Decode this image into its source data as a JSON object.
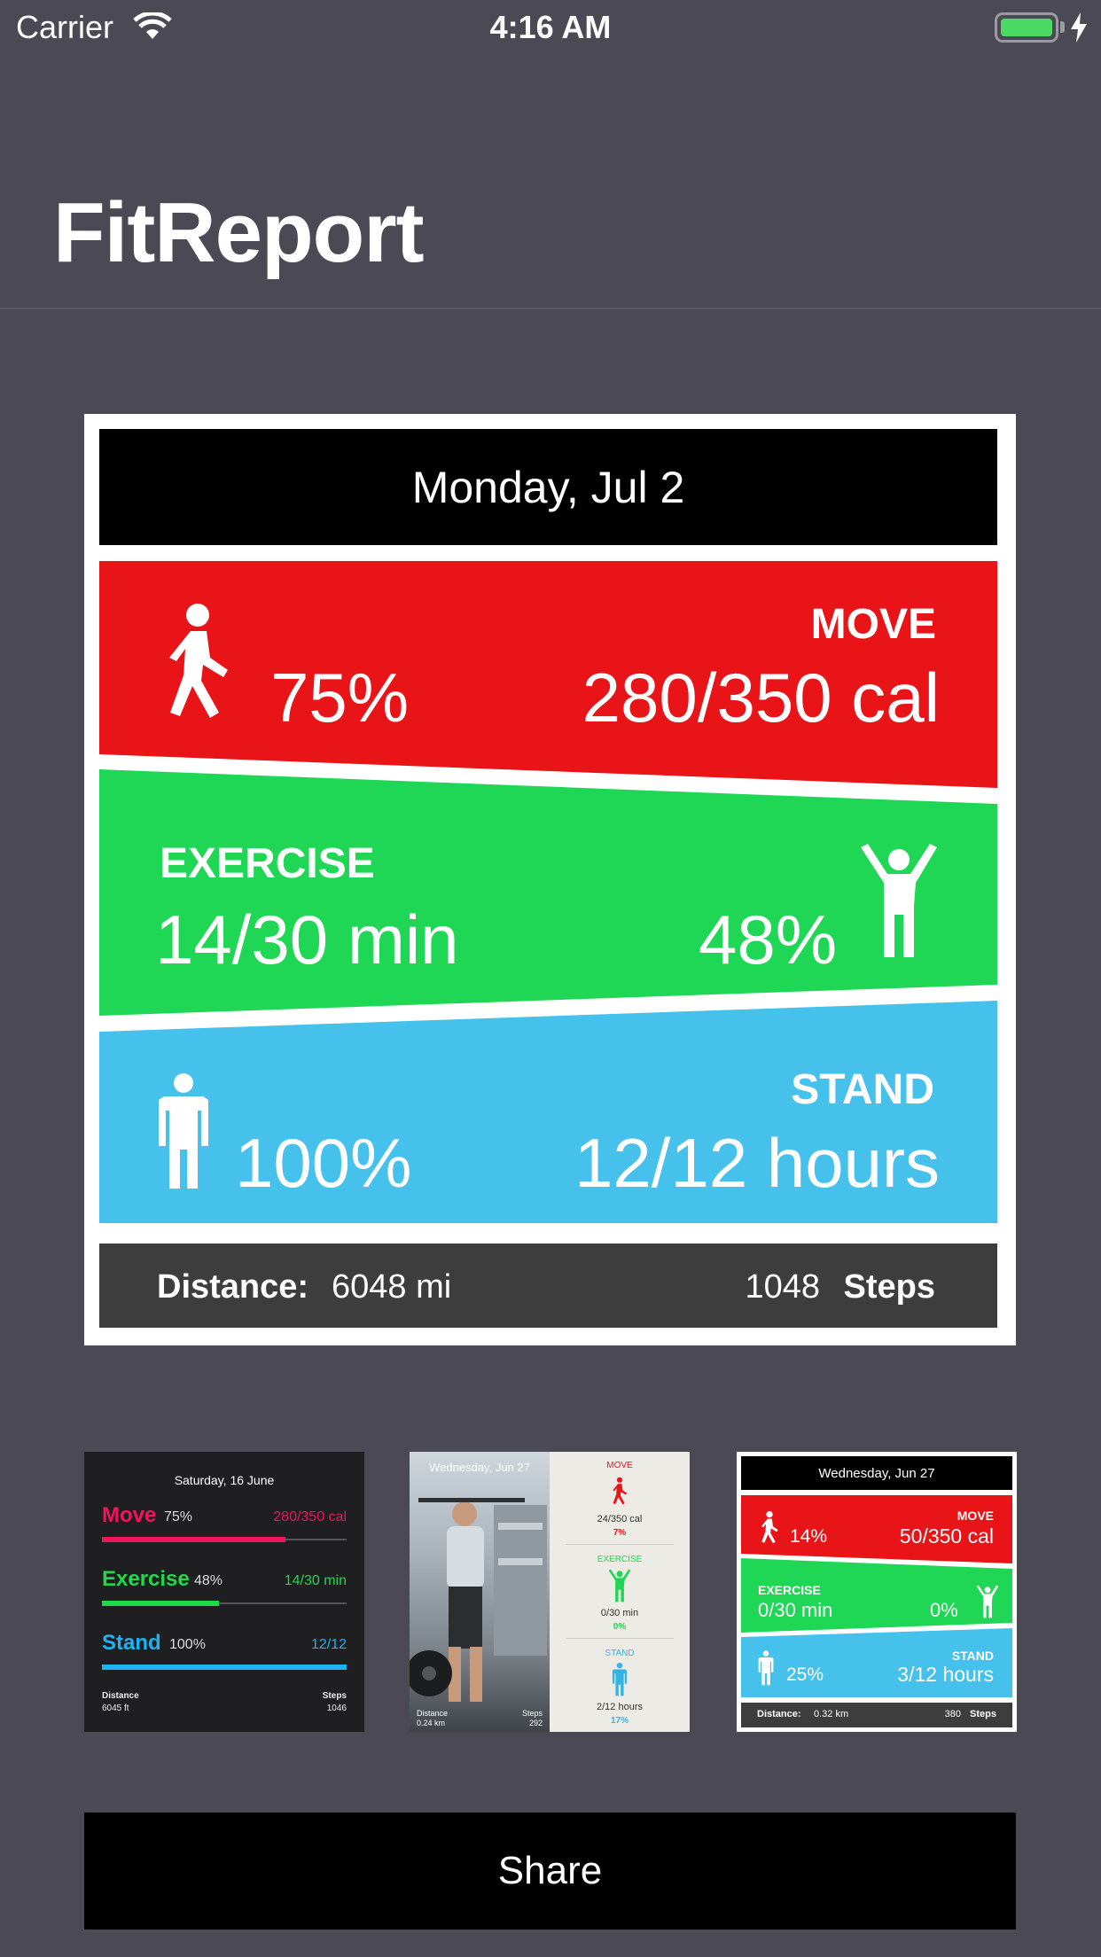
{
  "status_bar": {
    "carrier": "Carrier",
    "time": "4:16 AM",
    "battery_color": "#4cd964"
  },
  "app": {
    "title": "FitReport"
  },
  "main_card": {
    "date": "Monday, Jul 2",
    "move": {
      "label": "MOVE",
      "percent": "75%",
      "value": "280/350 cal",
      "color": "#e81417"
    },
    "exercise": {
      "label": "EXERCISE",
      "percent": "48%",
      "value": "14/30 min",
      "color": "#1fd655"
    },
    "stand": {
      "label": "STAND",
      "percent": "100%",
      "value": "12/12 hours",
      "color": "#46c1ec"
    },
    "distance_label": "Distance:",
    "distance_value": "6048 mi",
    "steps_value": "1048",
    "steps_label": "Steps"
  },
  "thumbnails": [
    {
      "style": "dark-bars",
      "date": "Saturday, 16 June",
      "rows": [
        {
          "name": "Move",
          "percent": "75%",
          "value": "280/350 cal",
          "color": "#f0155c",
          "fill": 0.75
        },
        {
          "name": "Exercise",
          "percent": "48%",
          "value": "14/30 min",
          "color": "#1fd94a",
          "fill": 0.48
        },
        {
          "name": "Stand",
          "percent": "100%",
          "value": "12/12",
          "color": "#1fb2f0",
          "fill": 1.0
        }
      ],
      "distance_label": "Distance",
      "distance_value": "6045 ft",
      "steps_label": "Steps",
      "steps_value": "1046"
    },
    {
      "style": "photo",
      "date": "Wednesday, Jun 27",
      "distance_label": "Distance",
      "distance_value": "0.24 km",
      "steps_label": "Steps",
      "steps_value": "292",
      "rows": [
        {
          "name": "MOVE",
          "value": "24/350 cal",
          "percent": "7%",
          "color": "#e81417"
        },
        {
          "name": "EXERCISE",
          "value": "0/30 min",
          "percent": "0%",
          "color": "#1fd655"
        },
        {
          "name": "STAND",
          "value": "2/12 hours",
          "percent": "17%",
          "color": "#34b4e4"
        }
      ]
    },
    {
      "style": "bands",
      "date": "Wednesday, Jun 27",
      "move": {
        "label": "MOVE",
        "percent": "14%",
        "value": "50/350 cal"
      },
      "exercise": {
        "label": "EXERCISE",
        "percent": "0%",
        "value": "0/30 min"
      },
      "stand": {
        "label": "STAND",
        "percent": "25%",
        "value": "3/12 hours"
      },
      "distance_label": "Distance:",
      "distance_value": "0.32 km",
      "steps_value": "380",
      "steps_label": "Steps"
    }
  ],
  "share_button": {
    "label": "Share"
  }
}
